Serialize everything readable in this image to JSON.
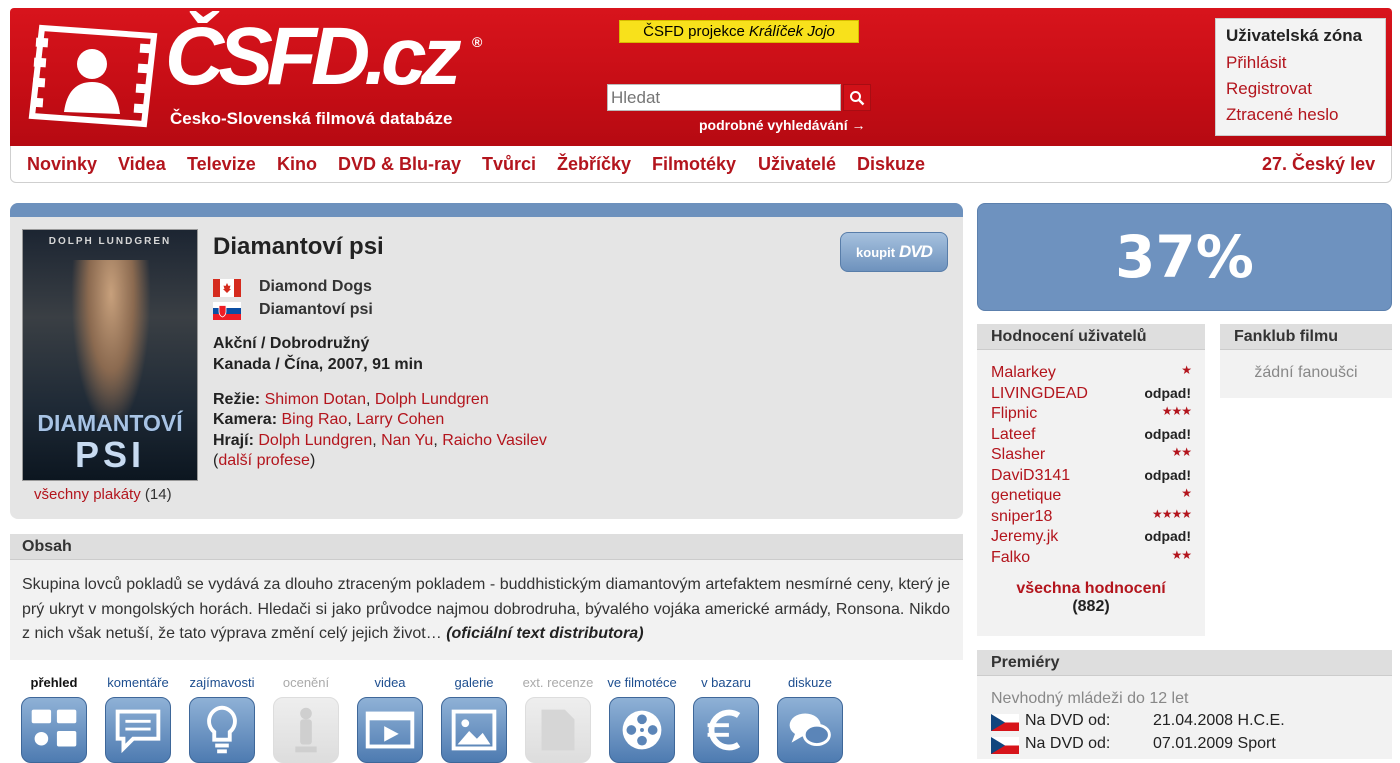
{
  "header": {
    "logo_text": "ČSFD.cz",
    "logo_subtitle": "Česko-Slovenská filmová databáze",
    "projekce_prefix": "ČSFD projekce",
    "projekce_title": "Králíček Jojo",
    "search_placeholder": "Hledat",
    "advanced_search": "podrobné vyhledávání →",
    "user_zone": {
      "title": "Uživatelská zóna",
      "links": [
        "Přihlásit",
        "Registrovat",
        "Ztracené heslo"
      ]
    }
  },
  "nav": {
    "items": [
      "Novinky",
      "Videa",
      "Televize",
      "Kino",
      "DVD & Blu-ray",
      "Tvůrci",
      "Žebříčky",
      "Filmotéky",
      "Uživatelé",
      "Diskuze"
    ],
    "right": "27. Český lev"
  },
  "film": {
    "title": "Diamantoví psi",
    "poster": {
      "actor_name": "DOLPH LUNDGREN",
      "title_line1": "DIAMANTOVÍ",
      "title_line2": "PSI"
    },
    "all_posters_label": "všechny plakáty",
    "all_posters_count": "(14)",
    "alt_names": [
      {
        "country": "Kanada",
        "name": "Diamond Dogs"
      },
      {
        "country": "Slovensko",
        "name": "Diamantoví psi"
      }
    ],
    "genre": "Akční / Dobrodružný",
    "origin": "Kanada / Čína, 2007, 91 min",
    "crew": {
      "directors_label": "Režie:",
      "directors": [
        "Shimon Dotan",
        "Dolph Lundgren"
      ],
      "camera_label": "Kamera:",
      "camera": [
        "Bing Rao",
        "Larry Cohen"
      ],
      "cast_label": "Hrají:",
      "cast": [
        "Dolph Lundgren",
        "Nan Yu",
        "Raicho Vasilev"
      ],
      "more_label": "další profese"
    },
    "buy_label": "koupit",
    "buy_dvd": "DVD",
    "plot_header": "Obsah",
    "plot": "Skupina lovců pokladů se vydává za dlouho ztraceným pokladem - buddhistickým diamantovým artefaktem nesmírné ceny, který je prý ukryt v mongolských horách. Hledači si jako průvodce najmou dobrodruha, bývalého vojáka americké armády, Ronsona. Nikdo z nich však netuší, že tato výprava změní celý jejich život…",
    "plot_source": "(oficiální text distributora)"
  },
  "tabs": [
    {
      "label": "přehled",
      "state": "selected",
      "icon": "overview-icon"
    },
    {
      "label": "komentáře",
      "state": "normal",
      "icon": "comment-icon"
    },
    {
      "label": "zajímavosti",
      "state": "normal",
      "icon": "lightbulb-icon"
    },
    {
      "label": "ocenění",
      "state": "disabled",
      "icon": "award-icon"
    },
    {
      "label": "videa",
      "state": "normal",
      "icon": "video-icon"
    },
    {
      "label": "galerie",
      "state": "normal",
      "icon": "gallery-icon"
    },
    {
      "label": "ext. recenze",
      "state": "disabled",
      "icon": "ext-review-icon"
    },
    {
      "label": "ve filmotéce",
      "state": "normal",
      "icon": "film-reel-icon"
    },
    {
      "label": "v bazaru",
      "state": "normal",
      "icon": "euro-icon"
    },
    {
      "label": "diskuze",
      "state": "normal",
      "icon": "discussion-icon"
    }
  ],
  "rating": {
    "value": "37%",
    "color": "#6e92bf"
  },
  "user_ratings": {
    "title": "Hodnocení uživatelů",
    "items": [
      {
        "user": "Malarkey",
        "stars": 1,
        "text": ""
      },
      {
        "user": "LIVINGDEAD",
        "stars": 0,
        "text": "odpad!"
      },
      {
        "user": "Flipnic",
        "stars": 3,
        "text": ""
      },
      {
        "user": "Lateef",
        "stars": 0,
        "text": "odpad!"
      },
      {
        "user": "Slasher",
        "stars": 2,
        "text": ""
      },
      {
        "user": "DaviD3141",
        "stars": 0,
        "text": "odpad!"
      },
      {
        "user": "genetique",
        "stars": 1,
        "text": ""
      },
      {
        "user": "sniper18",
        "stars": 4,
        "text": ""
      },
      {
        "user": "Jeremy.jk",
        "stars": 0,
        "text": "odpad!"
      },
      {
        "user": "Falko",
        "stars": 2,
        "text": ""
      }
    ],
    "all_label": "všechna hodnocení",
    "all_count": "(882)"
  },
  "fanklub": {
    "title": "Fanklub filmu",
    "empty": "žádní fanoušci"
  },
  "premiery": {
    "title": "Premiéry",
    "note": "Nevhodný mládeži do 12 let",
    "rows": [
      {
        "label": "Na DVD od:",
        "date": "21.04.2008 H.C.E."
      },
      {
        "label": "Na DVD od:",
        "date": "07.01.2009 Sport"
      }
    ]
  }
}
